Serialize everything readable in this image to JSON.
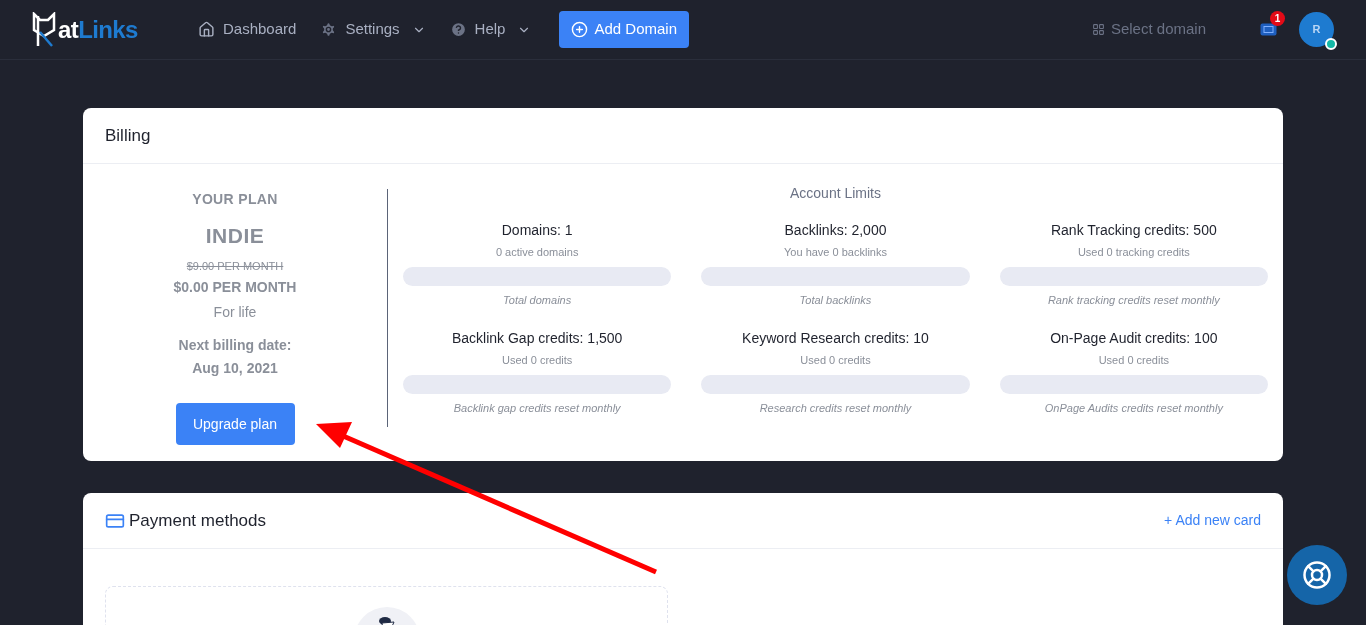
{
  "logo": {
    "main": "at",
    "accent": "Links"
  },
  "nav": [
    {
      "label": "Dashboard",
      "kind": "link"
    },
    {
      "label": "Settings",
      "kind": "dropdown"
    },
    {
      "label": "Help",
      "kind": "dropdown"
    }
  ],
  "add_domain": "Add Domain",
  "select_domain": "Select domain",
  "notifications": {
    "count": "1"
  },
  "avatar": {
    "initial": "R",
    "online": true
  },
  "billing": {
    "title": "Billing",
    "plan": {
      "heading": "YOUR PLAN",
      "name": "INDIE",
      "old_price": "$9.00 PER MONTH",
      "price": "$0.00 PER MONTH",
      "term": "For life",
      "next_label": "Next billing date:",
      "next_date": "Aug 10, 2021",
      "button": "Upgrade plan"
    },
    "limits_title": "Account Limits",
    "limits": [
      {
        "title": "Domains: 1",
        "subtitle": "0 active domains",
        "level": 0,
        "caption": "Total domains"
      },
      {
        "title": "Backlinks: 2,000",
        "subtitle": "You have 0 backlinks",
        "level": 0,
        "caption": "Total backlinks"
      },
      {
        "title": "Rank Tracking credits: 500",
        "subtitle": "Used 0 tracking credits",
        "level": 0,
        "caption": "Rank tracking credits reset monthly"
      },
      {
        "title": "Backlink Gap credits: 1,500",
        "subtitle": "Used 0 credits",
        "level": 0,
        "caption": "Backlink gap credits reset monthly"
      },
      {
        "title": "Keyword Research credits: 10",
        "subtitle": "Used 0 credits",
        "level": 0,
        "caption": "Research credits reset monthly"
      },
      {
        "title": "On-Page Audit credits: 100",
        "subtitle": "Used 0 credits",
        "level": 0,
        "caption": "OnPage Audits credits reset monthly"
      }
    ]
  },
  "payment": {
    "title": "Payment methods",
    "add_card": "+ Add new card"
  }
}
